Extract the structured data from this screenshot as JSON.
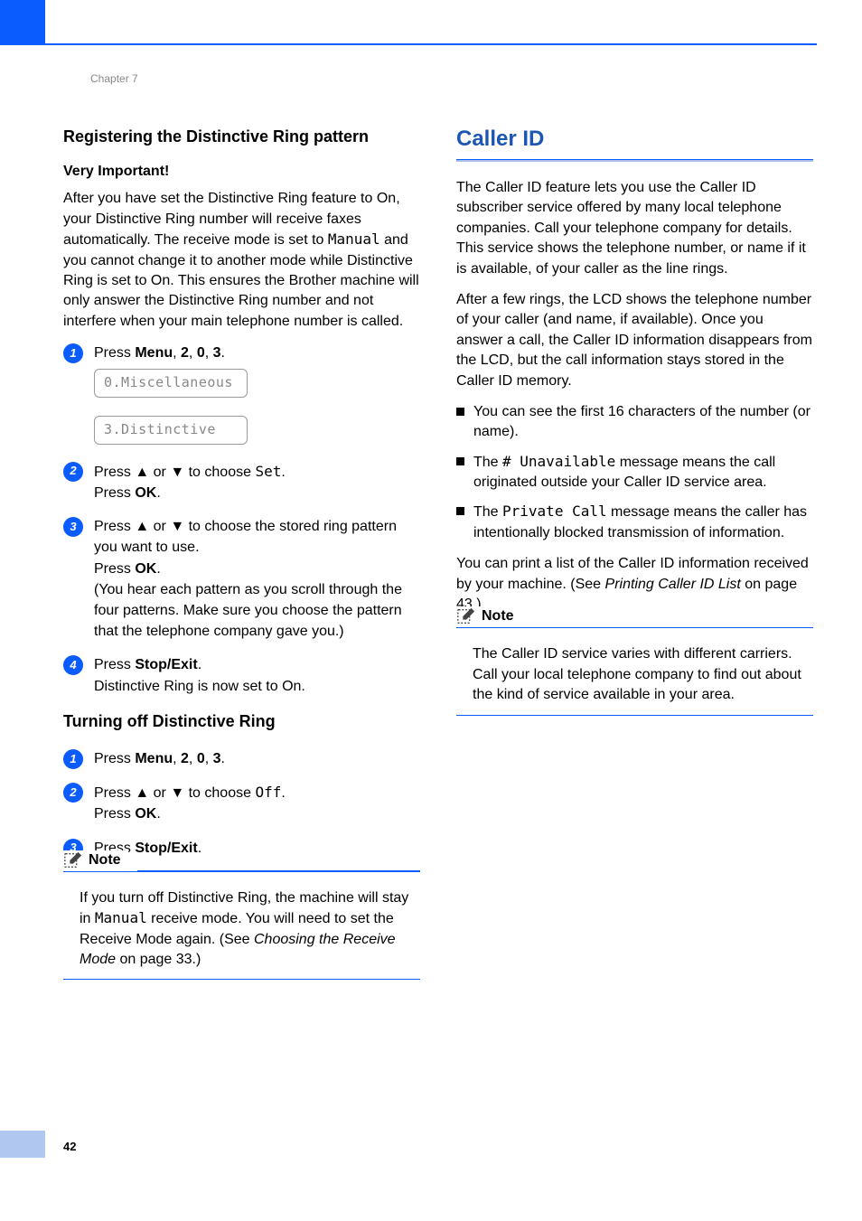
{
  "header": {
    "chapter": "Chapter 7"
  },
  "page_number": "42",
  "left": {
    "h3": "Registering the Distinctive Ring pattern",
    "h4": "Very Important!",
    "intro_before_mono": "After you have set the Distinctive Ring feature to On, your Distinctive Ring number will receive faxes automatically. The receive mode is set to ",
    "intro_mono": "Manual",
    "intro_after_mono": " and you cannot change it to another mode while Distinctive Ring is set to On. This ensures the Brother machine will only answer the Distinctive Ring number and not interfere when your main telephone number is called.",
    "steps1": {
      "s1_pre": "Press ",
      "s1_menu": "Menu",
      "s1_mid1": ", ",
      "s1_2": "2",
      "s1_mid2": ", ",
      "s1_0": "0",
      "s1_mid3": ", ",
      "s1_3": "3",
      "s1_end": ".",
      "lcd1": "0.Miscellaneous",
      "lcd2": "3.Distinctive",
      "s2_pre": "Press ",
      "s2_up": "▲",
      "s2_or": " or ",
      "s2_down": "▼",
      "s2_choose": " to choose ",
      "s2_set": "Set",
      "s2_dot": ".",
      "s2_pressok_pre": "Press ",
      "s2_ok": "OK",
      "s2_pressok_end": ".",
      "s3_pre": "Press ",
      "s3_up": "▲",
      "s3_or": " or ",
      "s3_down": "▼",
      "s3_rest": " to choose the stored ring pattern you want to use.",
      "s3_pressok_pre": "Press ",
      "s3_ok": "OK",
      "s3_pressok_end": ".",
      "s3_paren": "(You hear each pattern as you scroll through the four patterns. Make sure you choose the pattern that the telephone company gave you.)",
      "s4_pre": "Press ",
      "s4_stop": "Stop/Exit",
      "s4_end": ".",
      "s4_line2": "Distinctive Ring is now set to On."
    },
    "h3b": "Turning off Distinctive Ring",
    "steps2": {
      "s1_pre": "Press ",
      "s1_menu": "Menu",
      "s1_mid1": ", ",
      "s1_2": "2",
      "s1_mid2": ", ",
      "s1_0": "0",
      "s1_mid3": ", ",
      "s1_3": "3",
      "s1_end": ".",
      "s2_pre": "Press ",
      "s2_up": "▲",
      "s2_or": " or ",
      "s2_down": "▼",
      "s2_choose": " to choose ",
      "s2_off": "Off",
      "s2_dot": ".",
      "s2_pressok_pre": "Press ",
      "s2_ok": "OK",
      "s2_pressok_end": ".",
      "s3_pre": "Press ",
      "s3_stop": "Stop/Exit",
      "s3_end": "."
    },
    "note_label": "Note",
    "note_body_pre": "If you turn off Distinctive Ring, the machine will stay in ",
    "note_body_mono": "Manual",
    "note_body_mid": " receive mode. You will need to set the Receive Mode again. (See ",
    "note_body_link": "Choosing the Receive Mode",
    "note_body_end": " on page 33.)"
  },
  "right": {
    "h2": "Caller ID",
    "p1": "The Caller ID feature lets you use the Caller ID subscriber service offered by many local telephone companies. Call your telephone company for details. This service shows the telephone number, or name if it is available, of your caller as the line rings.",
    "p2": "After a few rings, the LCD shows the telephone number of your caller (and name, if available). Once you answer a call, the Caller ID information disappears from the LCD, but the call information stays stored in the Caller ID memory.",
    "b1": "You can see the first 16 characters of the number (or name).",
    "b2_pre": "The ",
    "b2_mono": "# Unavailable",
    "b2_post": " message means the call originated outside your Caller ID service area.",
    "b3_pre": "The ",
    "b3_mono": "Private Call",
    "b3_post": " message means the caller has intentionally blocked transmission of information.",
    "p3_pre": "You can print a list of the Caller ID information received by your machine. (See ",
    "p3_link": "Printing Caller ID List",
    "p3_end": " on page 43.)",
    "note_label": "Note",
    "note_body": "The Caller ID service varies with different carriers. Call your local telephone company to find out about the kind of service available in your area."
  }
}
